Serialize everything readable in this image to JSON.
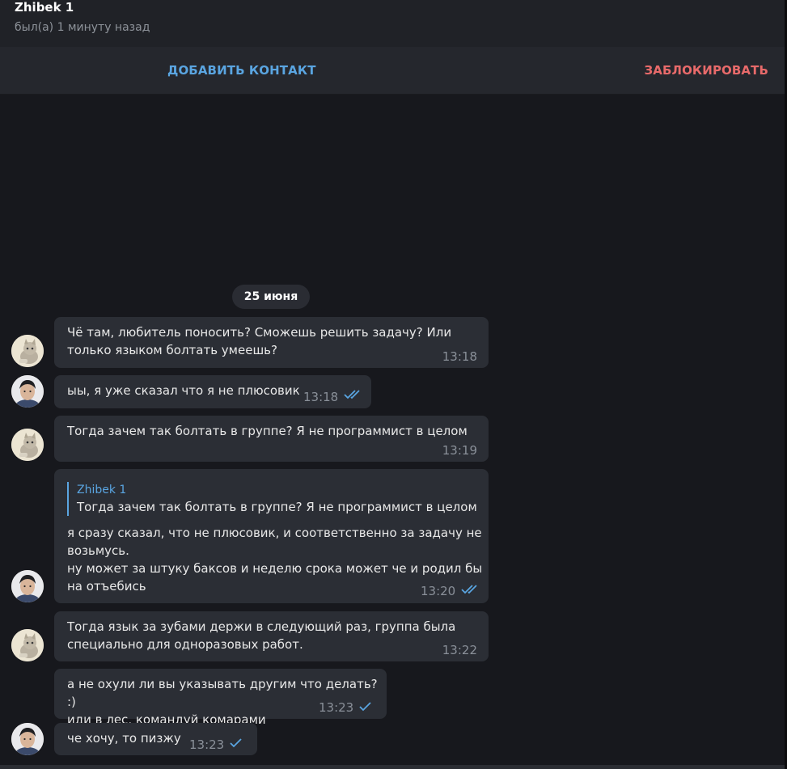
{
  "header": {
    "title": "Zhibek 1",
    "status": "был(а) 1 минуту назад"
  },
  "actions": {
    "add_contact": "ДОБАВИТЬ КОНТАКТ",
    "block": "ЗАБЛОКИРОВАТЬ"
  },
  "date_label": "25 июня",
  "messages": [
    {
      "text": "Чё там, любитель поносить? Сможешь решить задачу? Или\nтолько языком болтать умеешь?",
      "time": "13:18"
    },
    {
      "text": "ыы, я уже сказал что я не плюсовик",
      "time": "13:18"
    },
    {
      "text": "Тогда зачем так болтать в группе? Я не программист в целом",
      "time": "13:19"
    },
    {
      "reply_name": "Zhibek 1",
      "reply_text": "Тогда зачем так болтать в группе? Я не программист в целом",
      "text": "я сразу сказал, что не плюсовик, и соответственно за задачу не\nвозьмусь.\nну может за штуку баксов и неделю срока может че и родил бы\nна отъебись",
      "time": "13:20"
    },
    {
      "text": "Тогда язык за зубами держи в следующий раз, группа была\nспециально для одноразовых работ.",
      "time": "13:22"
    },
    {
      "text": "а не охули ли вы указывать другим что делать? :)\nиди в лес, командуй комарами",
      "time": "13:23"
    },
    {
      "text": "че хочу, то пизжу",
      "time": "13:23"
    }
  ],
  "colors": {
    "accent": "#5aa5e1",
    "danger": "#e86a6a",
    "bubble": "#2b2e35",
    "background": "#17181d"
  }
}
